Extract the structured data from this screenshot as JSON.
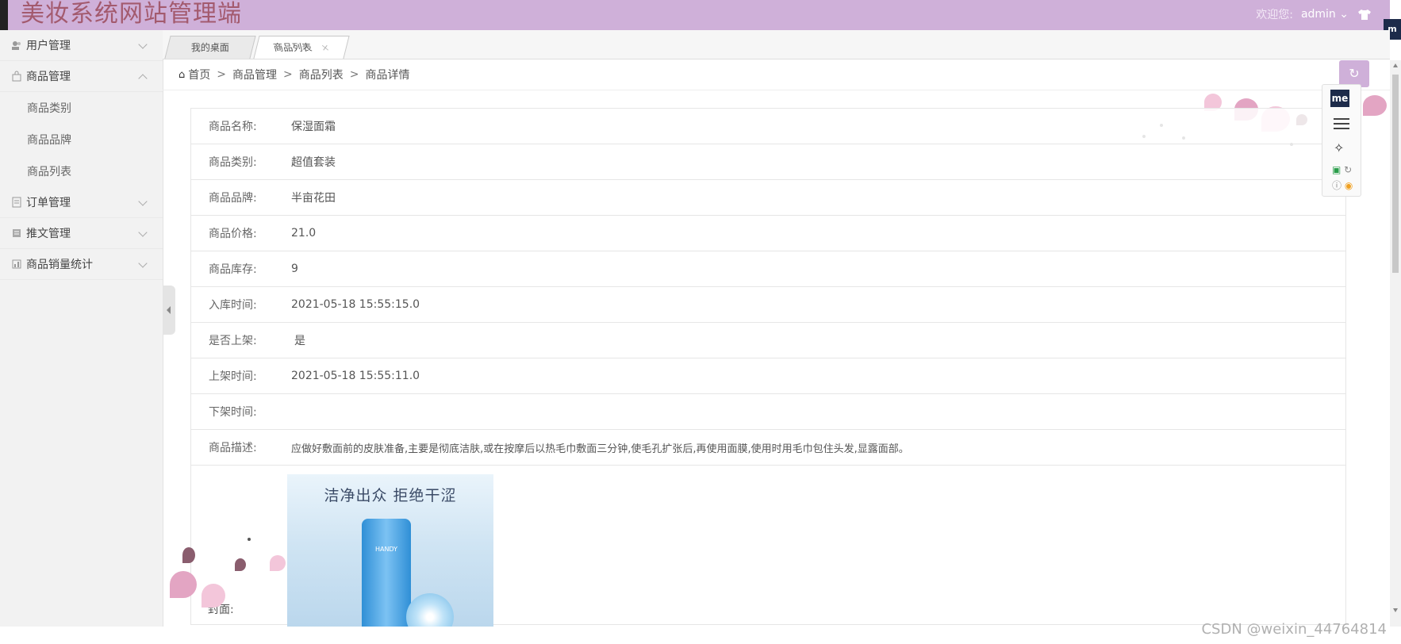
{
  "header": {
    "app_title": "美妆系统网站管理端",
    "welcome": "欢迎您:",
    "user": "admin",
    "chevron": "⌄"
  },
  "sidebar": {
    "items": [
      {
        "label": "用户管理",
        "expanded": false
      },
      {
        "label": "商品管理",
        "expanded": true,
        "children": [
          "商品类别",
          "商品品牌",
          "商品列表"
        ]
      },
      {
        "label": "订单管理",
        "expanded": false
      },
      {
        "label": "推文管理",
        "expanded": false
      },
      {
        "label": "商品销量统计",
        "expanded": false
      }
    ]
  },
  "tabs": [
    {
      "label": "我的桌面"
    },
    {
      "label": "商品列表",
      "close": "×"
    }
  ],
  "breadcrumb": {
    "home_icon": "⌂",
    "items": [
      "首页",
      "商品管理",
      "商品列表",
      "商品详情"
    ],
    "separator": ">"
  },
  "refresh_icon": "↻",
  "detail": {
    "rows": [
      {
        "label": "商品名称:",
        "value": "保湿面霜"
      },
      {
        "label": "商品类别:",
        "value": "超值套装"
      },
      {
        "label": "商品品牌:",
        "value": "半亩花田"
      },
      {
        "label": "商品价格:",
        "value": "21.0"
      },
      {
        "label": "商品库存:",
        "value": "9"
      },
      {
        "label": "入库时间:",
        "value": "2021-05-18 15:55:15.0"
      },
      {
        "label": "是否上架:",
        "value": "是"
      },
      {
        "label": "上架时间:",
        "value": "2021-05-18 15:55:11.0"
      },
      {
        "label": "下架时间:",
        "value": ""
      },
      {
        "label": "商品描述:",
        "value": "应做好敷面前的皮肤准备,主要是彻底洁肤,或在按摩后以热毛巾敷面三分钟,使毛孔扩张后,再使用面膜,使用时用毛巾包住头发,显露面部。"
      }
    ],
    "cover_label": "封面:",
    "cover_slogan": "洁净出众 拒绝干涩",
    "cover_brand": "HANDY"
  },
  "toolbar": {
    "me_label": "me"
  },
  "side_tag": "m",
  "watermark": "CSDN @weixin_44764814",
  "colors": {
    "header_bg": "#cfb0d9",
    "title_color": "#a35a6e"
  }
}
